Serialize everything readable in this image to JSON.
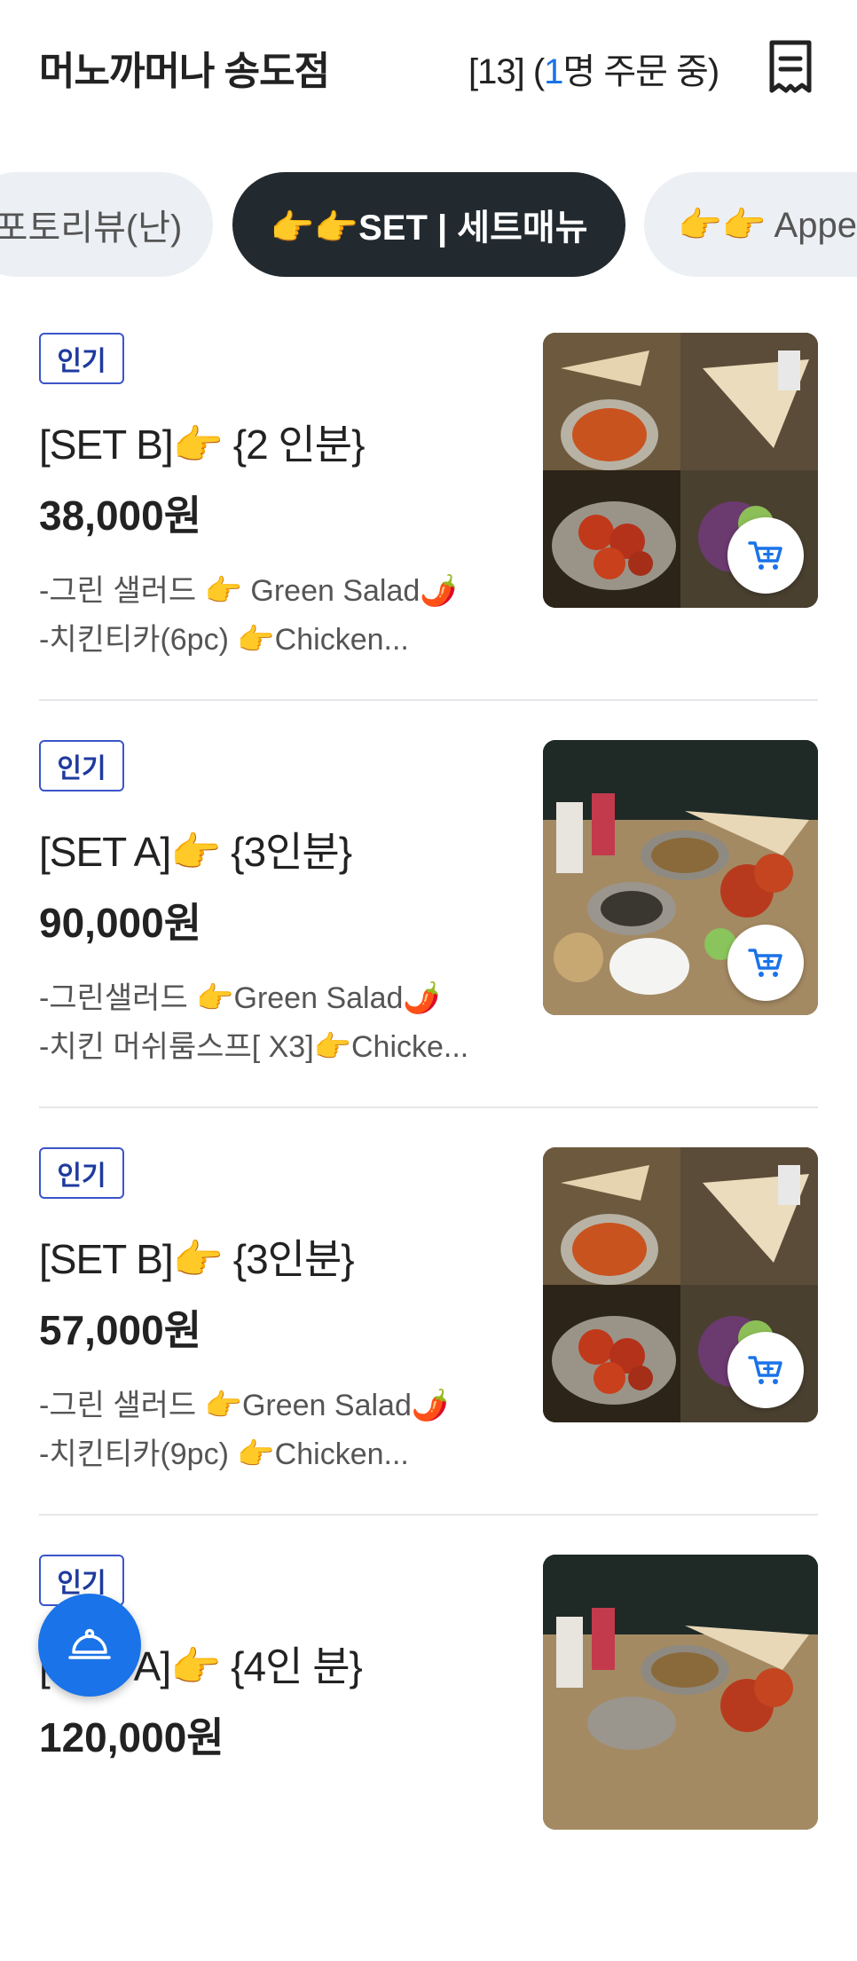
{
  "header": {
    "store_name": "머노까머나 송도점",
    "order_prefix": "[13] (",
    "order_count": "1",
    "order_suffix": "명 주문 중)"
  },
  "tabs": [
    {
      "label": "포토리뷰(난)",
      "active": false
    },
    {
      "label": "👉👉SET | 세트매뉴",
      "active": true
    },
    {
      "label": "👉👉 Appe",
      "active": false
    }
  ],
  "menu_items": [
    {
      "badge": "인기",
      "name": "[SET B]👉 {2 인분}",
      "price": "38,000원",
      "desc_line1": "-그린 샐러드 👉 Green Salad🌶️",
      "desc_line2": "-치킨티카(6pc) 👉Chicken...",
      "photo": "naan-curry-tikka-collage"
    },
    {
      "badge": "인기",
      "name": "[SET A]👉 {3인분}",
      "price": "90,000원",
      "desc_line1": "-그린샐러드 👉Green Salad🌶️",
      "desc_line2": "-치킨 머쉬룸스프[ X3]👉Chicke...",
      "photo": "tandoori-table-spread"
    },
    {
      "badge": "인기",
      "name": "[SET B]👉 {3인분}",
      "price": "57,000원",
      "desc_line1": "-그린 샐러드 👉Green Salad🌶️",
      "desc_line2": "-치킨티카(9pc) 👉Chicken...",
      "photo": "naan-curry-tikka-collage"
    },
    {
      "badge": "인기",
      "name": "[SET A]👉 {4인 분}",
      "price": "120,000원",
      "desc_line1": "",
      "desc_line2": "",
      "photo": "tandoori-table-spread"
    }
  ],
  "icons": {
    "receipt": "receipt-icon",
    "cart": "add-to-cart-icon",
    "fab": "cloche-service-icon"
  },
  "colors": {
    "accent": "#1a73e8",
    "active_tab": "#222a30",
    "badge": "#3b55c8"
  }
}
